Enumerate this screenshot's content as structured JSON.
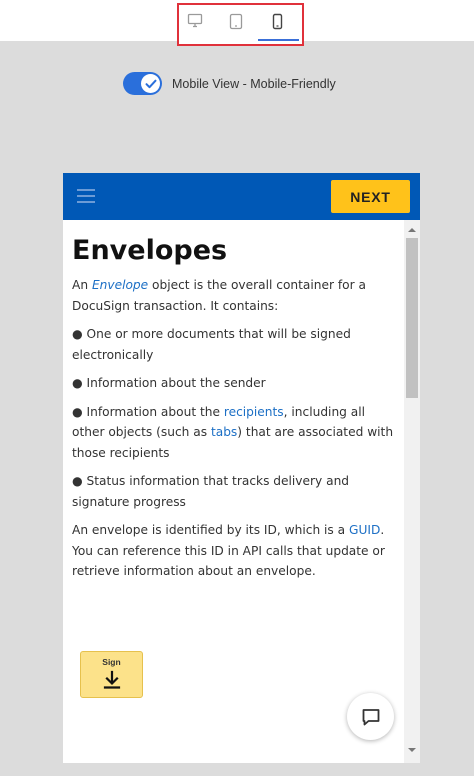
{
  "device_toolbar": {
    "icons": [
      "desktop-icon",
      "tablet-icon",
      "mobile-icon"
    ],
    "selected": "mobile",
    "highlight_color": "#e0313b",
    "underline_color": "#3a6fd8"
  },
  "view_toggle": {
    "checked": true,
    "label": "Mobile View - Mobile-Friendly",
    "color": "#2a6fdb"
  },
  "phone": {
    "header": {
      "menu_icon": "hamburger-icon",
      "next_label": "NEXT",
      "bar_color": "#0058b6",
      "button_color": "#ffc21a"
    },
    "content": {
      "title": "Envelopes",
      "intro": {
        "before": "An ",
        "link": "Envelope",
        "after": " object is the overall container for a DocuSign transaction. It contains:"
      },
      "bullets": [
        {
          "text": "● One or more documents that will be signed electronically"
        },
        {
          "text": "● Information about the sender"
        },
        {
          "before": "● Information about the ",
          "link1": "recipients",
          "middle": ", including all other objects (such as ",
          "link2": "tabs",
          "after": ") that are associated with those recipients"
        },
        {
          "text": "● Status information that tracks delivery and signature progress"
        }
      ],
      "outro": {
        "before": "An envelope is identified by its ID, which is a ",
        "link": "GUID",
        "after": ". You can reference this ID in API calls that update or retrieve information about an envelope."
      }
    },
    "sign_button": {
      "label": "Sign",
      "icon": "download-arrow-icon"
    },
    "chat_button": {
      "icon": "chat-bubble-icon"
    }
  }
}
